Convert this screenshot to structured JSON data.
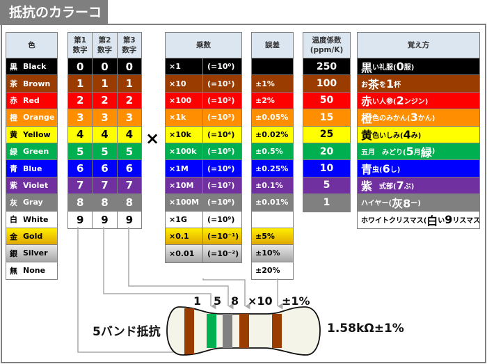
{
  "title": "抵抗のカラーコード",
  "headers": {
    "color": "色",
    "digit1": "第1\n数字",
    "digit2": "第2\n数字",
    "digit3": "第3\n数字",
    "multiplier": "乗数",
    "tolerance": "誤差",
    "tempco": "温度係数\n(ppm/K)",
    "mnemonic": "覚え方"
  },
  "times_sign": "×",
  "colors": [
    {
      "kanji": "黒",
      "name": "Black",
      "bg": "#000000",
      "fg": "#ffffff",
      "digit": "0",
      "mult": "×1",
      "pow": "(=10⁰)",
      "tol": "",
      "tc": "250",
      "mn": [
        [
          "黒",
          1
        ],
        [
          "い礼服(",
          0
        ],
        [
          "0",
          1
        ],
        [
          "服)",
          0
        ]
      ]
    },
    {
      "kanji": "茶",
      "name": "Brown",
      "bg": "#9a3c00",
      "fg": "#ffffff",
      "digit": "1",
      "mult": "×10",
      "pow": "(=10¹)",
      "tol": "±1%",
      "tc": "100",
      "mn": [
        [
          "お",
          0
        ],
        [
          "茶",
          1
        ],
        [
          "を",
          0
        ],
        [
          "1",
          1
        ],
        [
          "杯",
          0
        ]
      ]
    },
    {
      "kanji": "赤",
      "name": "Red",
      "bg": "#ff0000",
      "fg": "#ffffff",
      "digit": "2",
      "mult": "×100",
      "pow": "(=10²)",
      "tol": "±2%",
      "tc": "50",
      "mn": [
        [
          "赤",
          1
        ],
        [
          "い人参(",
          0
        ],
        [
          "2",
          1
        ],
        [
          "ンジン)",
          0
        ]
      ]
    },
    {
      "kanji": "橙",
      "name": "Orange",
      "bg": "#ff8f00",
      "fg": "#ffffff",
      "digit": "3",
      "mult": "×1k",
      "pow": "(=10³)",
      "tol": "±0.05%",
      "tc": "15",
      "mn": [
        [
          "橙",
          1
        ],
        [
          "色のみかん(",
          0
        ],
        [
          "3",
          1
        ],
        [
          "かん)",
          0
        ]
      ]
    },
    {
      "kanji": "黄",
      "name": "Yellow",
      "bg": "#ffff00",
      "fg": "#000000",
      "digit": "4",
      "mult": "×10k",
      "pow": "(=10⁴)",
      "tol": "±0.02%",
      "tc": "25",
      "mn": [
        [
          "黄",
          1
        ],
        [
          "色いしみ(",
          0
        ],
        [
          "4",
          1
        ],
        [
          "み)",
          0
        ]
      ]
    },
    {
      "kanji": "緑",
      "name": "Green",
      "bg": "#00b050",
      "fg": "#ffffff",
      "digit": "5",
      "mult": "×100k",
      "pow": "(=10⁵)",
      "tol": "±0.5%",
      "tc": "20",
      "mn": [
        [
          "五月　みどり(",
          0
        ],
        [
          "5",
          1
        ],
        [
          "月 ",
          0
        ],
        [
          "緑",
          1
        ],
        [
          ")",
          0
        ]
      ]
    },
    {
      "kanji": "青",
      "name": "Blue",
      "bg": "#0000ff",
      "fg": "#ffffff",
      "digit": "6",
      "mult": "×1M",
      "pow": "(=10⁶)",
      "tol": "±0.25%",
      "tc": "10",
      "mn": [
        [
          "青",
          1
        ],
        [
          "虫(",
          0
        ],
        [
          "6",
          1
        ],
        [
          "し)",
          0
        ]
      ]
    },
    {
      "kanji": "紫",
      "name": "Violet",
      "bg": "#7030a0",
      "fg": "#ffffff",
      "digit": "7",
      "mult": "×10M",
      "pow": "(=10⁷)",
      "tol": "±0.1%",
      "tc": "5",
      "mn": [
        [
          "紫",
          1
        ],
        [
          "　式部(",
          0
        ],
        [
          "7",
          1
        ],
        [
          "ぶ)",
          0
        ]
      ]
    },
    {
      "kanji": "灰",
      "name": "Gray",
      "bg": "#808080",
      "fg": "#ffffff",
      "digit": "8",
      "mult": "×100M",
      "pow": "(=10⁸)",
      "tol": "±0.01%",
      "tc": "1",
      "mn": [
        [
          "ハイヤー(",
          0
        ],
        [
          "灰8",
          1
        ],
        [
          "ー)",
          0
        ]
      ]
    },
    {
      "kanji": "白",
      "name": "White",
      "bg": "#ffffff",
      "fg": "#000000",
      "digit": "9",
      "mult": "×1G",
      "pow": "(=10⁹)",
      "tol": "",
      "tc": null,
      "mn": [
        [
          "ホワイトクリスマス(",
          0
        ],
        [
          "白",
          1
        ],
        [
          "い",
          0
        ],
        [
          "9",
          1
        ],
        [
          "リスマス)",
          0
        ]
      ]
    },
    {
      "kanji": "金",
      "name": "Gold",
      "bg": "linear-gradient(#ffee00,#e0a800)",
      "fg": "#000000",
      "digit": null,
      "mult": "×0.1",
      "pow": "(=10⁻¹)",
      "tol": "±5%",
      "tc": null,
      "mn": null
    },
    {
      "kanji": "銀",
      "name": "Silver",
      "bg": "linear-gradient(#e8e8e8,#a6a6a6)",
      "fg": "#000000",
      "digit": null,
      "mult": "×0.01",
      "pow": "(=10⁻²)",
      "tol": "±10%",
      "tc": null,
      "mn": null
    },
    {
      "kanji": "無",
      "name": "None",
      "bg": "#ffffff",
      "fg": "#000000",
      "digit": null,
      "mult": null,
      "pow": null,
      "tol": "±20%",
      "tc": null,
      "mn": null
    }
  ],
  "example": {
    "label": "5バンド抵抗",
    "band_labels": [
      "1",
      "5",
      "8",
      "×10",
      "±1%"
    ],
    "band_colors": [
      "#9a3c00",
      "#00b050",
      "#808080",
      "#9a3c00",
      "#9a3c00"
    ],
    "value": "1.58kΩ±1%"
  }
}
